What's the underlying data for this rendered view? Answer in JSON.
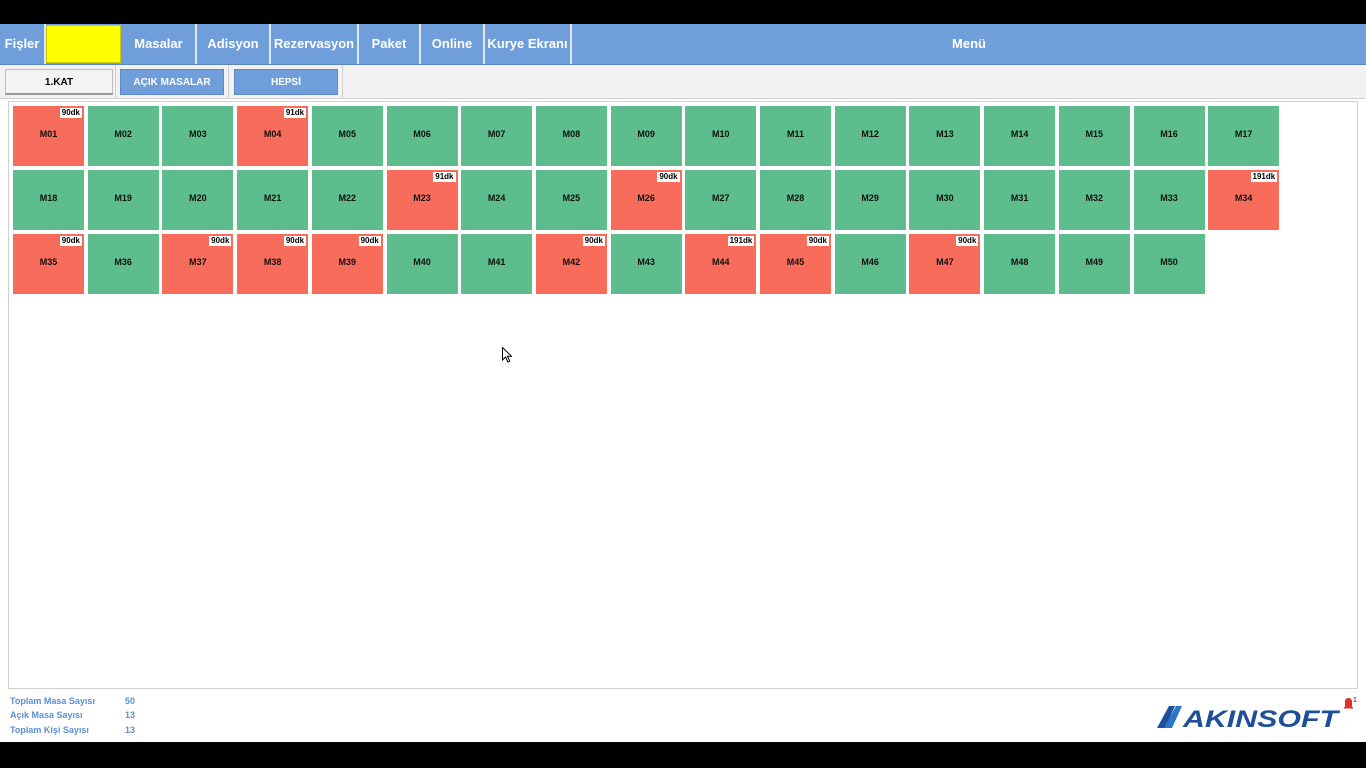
{
  "menubar": {
    "items": [
      {
        "label": "Fişler"
      },
      {
        "label": "Masalar"
      },
      {
        "label": "Adisyon"
      },
      {
        "label": "Rezervasyon"
      },
      {
        "label": "Paket"
      },
      {
        "label": "Online"
      },
      {
        "label": "Kurye Ekranı"
      },
      {
        "label": "Menü"
      }
    ],
    "search": {
      "value": "",
      "placeholder": ""
    }
  },
  "tabs": [
    {
      "label": "1.KAT",
      "active": true
    },
    {
      "label": "AÇIK MASALAR"
    },
    {
      "label": "HEPSİ"
    }
  ],
  "colors": {
    "free": "#5dbd8d",
    "open": "#f86c5c",
    "menubar": "#6f9edb",
    "search_bg": "#ffff00"
  },
  "tables": [
    {
      "name": "M01",
      "status": "open",
      "time": "90dk"
    },
    {
      "name": "M02",
      "status": "free",
      "time": ""
    },
    {
      "name": "M03",
      "status": "free",
      "time": ""
    },
    {
      "name": "M04",
      "status": "open",
      "time": "91dk"
    },
    {
      "name": "M05",
      "status": "free",
      "time": ""
    },
    {
      "name": "M06",
      "status": "free",
      "time": ""
    },
    {
      "name": "M07",
      "status": "free",
      "time": ""
    },
    {
      "name": "M08",
      "status": "free",
      "time": ""
    },
    {
      "name": "M09",
      "status": "free",
      "time": ""
    },
    {
      "name": "M10",
      "status": "free",
      "time": ""
    },
    {
      "name": "M11",
      "status": "free",
      "time": ""
    },
    {
      "name": "M12",
      "status": "free",
      "time": ""
    },
    {
      "name": "M13",
      "status": "free",
      "time": ""
    },
    {
      "name": "M14",
      "status": "free",
      "time": ""
    },
    {
      "name": "M15",
      "status": "free",
      "time": ""
    },
    {
      "name": "M16",
      "status": "free",
      "time": ""
    },
    {
      "name": "M17",
      "status": "free",
      "time": ""
    },
    {
      "name": "M18",
      "status": "free",
      "time": ""
    },
    {
      "name": "M19",
      "status": "free",
      "time": ""
    },
    {
      "name": "M20",
      "status": "free",
      "time": ""
    },
    {
      "name": "M21",
      "status": "free",
      "time": ""
    },
    {
      "name": "M22",
      "status": "free",
      "time": ""
    },
    {
      "name": "M23",
      "status": "open",
      "time": "91dk"
    },
    {
      "name": "M24",
      "status": "free",
      "time": ""
    },
    {
      "name": "M25",
      "status": "free",
      "time": ""
    },
    {
      "name": "M26",
      "status": "open",
      "time": "90dk"
    },
    {
      "name": "M27",
      "status": "free",
      "time": ""
    },
    {
      "name": "M28",
      "status": "free",
      "time": ""
    },
    {
      "name": "M29",
      "status": "free",
      "time": ""
    },
    {
      "name": "M30",
      "status": "free",
      "time": ""
    },
    {
      "name": "M31",
      "status": "free",
      "time": ""
    },
    {
      "name": "M32",
      "status": "free",
      "time": ""
    },
    {
      "name": "M33",
      "status": "free",
      "time": ""
    },
    {
      "name": "M34",
      "status": "open",
      "time": "191dk"
    },
    {
      "name": "M35",
      "status": "open",
      "time": "90dk"
    },
    {
      "name": "M36",
      "status": "free",
      "time": ""
    },
    {
      "name": "M37",
      "status": "open",
      "time": "90dk"
    },
    {
      "name": "M38",
      "status": "open",
      "time": "90dk"
    },
    {
      "name": "M39",
      "status": "open",
      "time": "90dk"
    },
    {
      "name": "M40",
      "status": "free",
      "time": ""
    },
    {
      "name": "M41",
      "status": "free",
      "time": ""
    },
    {
      "name": "M42",
      "status": "open",
      "time": "90dk"
    },
    {
      "name": "M43",
      "status": "free",
      "time": ""
    },
    {
      "name": "M44",
      "status": "open",
      "time": "191dk"
    },
    {
      "name": "M45",
      "status": "open",
      "time": "90dk"
    },
    {
      "name": "M46",
      "status": "free",
      "time": ""
    },
    {
      "name": "M47",
      "status": "open",
      "time": "90dk"
    },
    {
      "name": "M48",
      "status": "free",
      "time": ""
    },
    {
      "name": "M49",
      "status": "free",
      "time": ""
    },
    {
      "name": "M50",
      "status": "free",
      "time": ""
    }
  ],
  "footer": {
    "stats": [
      {
        "label": "Toplam Masa Sayısı",
        "value": "50"
      },
      {
        "label": "Açık Masa Sayısı",
        "value": "13"
      },
      {
        "label": "Toplam Kişi Sayısı",
        "value": "13"
      }
    ],
    "logo_text": "AKINSOFT",
    "notification_count": "1"
  },
  "icons": {
    "logo": "akinsoft-logo",
    "notification": "bell-icon",
    "cursor": "mouse-pointer-icon"
  }
}
